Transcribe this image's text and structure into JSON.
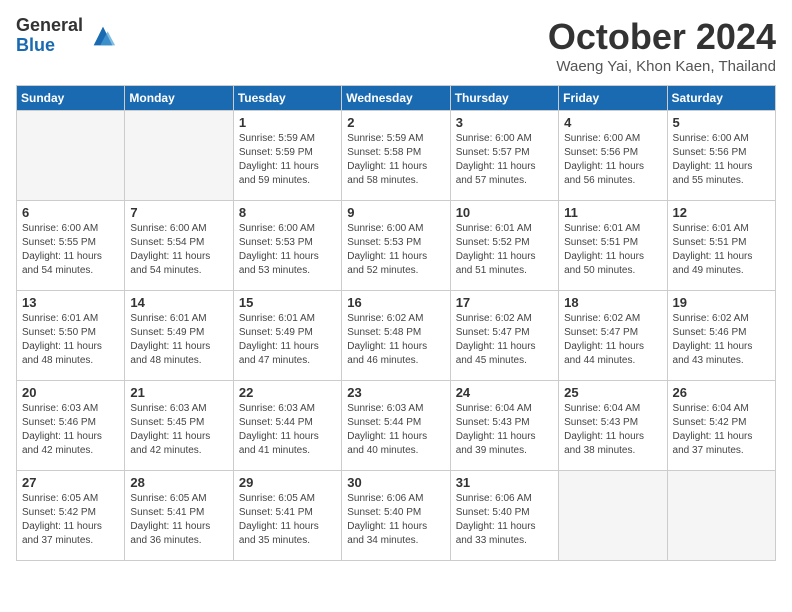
{
  "header": {
    "logo_general": "General",
    "logo_blue": "Blue",
    "month_title": "October 2024",
    "location": "Waeng Yai, Khon Kaen, Thailand"
  },
  "weekdays": [
    "Sunday",
    "Monday",
    "Tuesday",
    "Wednesday",
    "Thursday",
    "Friday",
    "Saturday"
  ],
  "weeks": [
    [
      {
        "day": "",
        "empty": true
      },
      {
        "day": "",
        "empty": true
      },
      {
        "day": "1",
        "sunrise": "Sunrise: 5:59 AM",
        "sunset": "Sunset: 5:59 PM",
        "daylight": "Daylight: 11 hours and 59 minutes."
      },
      {
        "day": "2",
        "sunrise": "Sunrise: 5:59 AM",
        "sunset": "Sunset: 5:58 PM",
        "daylight": "Daylight: 11 hours and 58 minutes."
      },
      {
        "day": "3",
        "sunrise": "Sunrise: 6:00 AM",
        "sunset": "Sunset: 5:57 PM",
        "daylight": "Daylight: 11 hours and 57 minutes."
      },
      {
        "day": "4",
        "sunrise": "Sunrise: 6:00 AM",
        "sunset": "Sunset: 5:56 PM",
        "daylight": "Daylight: 11 hours and 56 minutes."
      },
      {
        "day": "5",
        "sunrise": "Sunrise: 6:00 AM",
        "sunset": "Sunset: 5:56 PM",
        "daylight": "Daylight: 11 hours and 55 minutes."
      }
    ],
    [
      {
        "day": "6",
        "sunrise": "Sunrise: 6:00 AM",
        "sunset": "Sunset: 5:55 PM",
        "daylight": "Daylight: 11 hours and 54 minutes."
      },
      {
        "day": "7",
        "sunrise": "Sunrise: 6:00 AM",
        "sunset": "Sunset: 5:54 PM",
        "daylight": "Daylight: 11 hours and 54 minutes."
      },
      {
        "day": "8",
        "sunrise": "Sunrise: 6:00 AM",
        "sunset": "Sunset: 5:53 PM",
        "daylight": "Daylight: 11 hours and 53 minutes."
      },
      {
        "day": "9",
        "sunrise": "Sunrise: 6:00 AM",
        "sunset": "Sunset: 5:53 PM",
        "daylight": "Daylight: 11 hours and 52 minutes."
      },
      {
        "day": "10",
        "sunrise": "Sunrise: 6:01 AM",
        "sunset": "Sunset: 5:52 PM",
        "daylight": "Daylight: 11 hours and 51 minutes."
      },
      {
        "day": "11",
        "sunrise": "Sunrise: 6:01 AM",
        "sunset": "Sunset: 5:51 PM",
        "daylight": "Daylight: 11 hours and 50 minutes."
      },
      {
        "day": "12",
        "sunrise": "Sunrise: 6:01 AM",
        "sunset": "Sunset: 5:51 PM",
        "daylight": "Daylight: 11 hours and 49 minutes."
      }
    ],
    [
      {
        "day": "13",
        "sunrise": "Sunrise: 6:01 AM",
        "sunset": "Sunset: 5:50 PM",
        "daylight": "Daylight: 11 hours and 48 minutes."
      },
      {
        "day": "14",
        "sunrise": "Sunrise: 6:01 AM",
        "sunset": "Sunset: 5:49 PM",
        "daylight": "Daylight: 11 hours and 48 minutes."
      },
      {
        "day": "15",
        "sunrise": "Sunrise: 6:01 AM",
        "sunset": "Sunset: 5:49 PM",
        "daylight": "Daylight: 11 hours and 47 minutes."
      },
      {
        "day": "16",
        "sunrise": "Sunrise: 6:02 AM",
        "sunset": "Sunset: 5:48 PM",
        "daylight": "Daylight: 11 hours and 46 minutes."
      },
      {
        "day": "17",
        "sunrise": "Sunrise: 6:02 AM",
        "sunset": "Sunset: 5:47 PM",
        "daylight": "Daylight: 11 hours and 45 minutes."
      },
      {
        "day": "18",
        "sunrise": "Sunrise: 6:02 AM",
        "sunset": "Sunset: 5:47 PM",
        "daylight": "Daylight: 11 hours and 44 minutes."
      },
      {
        "day": "19",
        "sunrise": "Sunrise: 6:02 AM",
        "sunset": "Sunset: 5:46 PM",
        "daylight": "Daylight: 11 hours and 43 minutes."
      }
    ],
    [
      {
        "day": "20",
        "sunrise": "Sunrise: 6:03 AM",
        "sunset": "Sunset: 5:46 PM",
        "daylight": "Daylight: 11 hours and 42 minutes."
      },
      {
        "day": "21",
        "sunrise": "Sunrise: 6:03 AM",
        "sunset": "Sunset: 5:45 PM",
        "daylight": "Daylight: 11 hours and 42 minutes."
      },
      {
        "day": "22",
        "sunrise": "Sunrise: 6:03 AM",
        "sunset": "Sunset: 5:44 PM",
        "daylight": "Daylight: 11 hours and 41 minutes."
      },
      {
        "day": "23",
        "sunrise": "Sunrise: 6:03 AM",
        "sunset": "Sunset: 5:44 PM",
        "daylight": "Daylight: 11 hours and 40 minutes."
      },
      {
        "day": "24",
        "sunrise": "Sunrise: 6:04 AM",
        "sunset": "Sunset: 5:43 PM",
        "daylight": "Daylight: 11 hours and 39 minutes."
      },
      {
        "day": "25",
        "sunrise": "Sunrise: 6:04 AM",
        "sunset": "Sunset: 5:43 PM",
        "daylight": "Daylight: 11 hours and 38 minutes."
      },
      {
        "day": "26",
        "sunrise": "Sunrise: 6:04 AM",
        "sunset": "Sunset: 5:42 PM",
        "daylight": "Daylight: 11 hours and 37 minutes."
      }
    ],
    [
      {
        "day": "27",
        "sunrise": "Sunrise: 6:05 AM",
        "sunset": "Sunset: 5:42 PM",
        "daylight": "Daylight: 11 hours and 37 minutes."
      },
      {
        "day": "28",
        "sunrise": "Sunrise: 6:05 AM",
        "sunset": "Sunset: 5:41 PM",
        "daylight": "Daylight: 11 hours and 36 minutes."
      },
      {
        "day": "29",
        "sunrise": "Sunrise: 6:05 AM",
        "sunset": "Sunset: 5:41 PM",
        "daylight": "Daylight: 11 hours and 35 minutes."
      },
      {
        "day": "30",
        "sunrise": "Sunrise: 6:06 AM",
        "sunset": "Sunset: 5:40 PM",
        "daylight": "Daylight: 11 hours and 34 minutes."
      },
      {
        "day": "31",
        "sunrise": "Sunrise: 6:06 AM",
        "sunset": "Sunset: 5:40 PM",
        "daylight": "Daylight: 11 hours and 33 minutes."
      },
      {
        "day": "",
        "empty": true
      },
      {
        "day": "",
        "empty": true
      }
    ]
  ]
}
